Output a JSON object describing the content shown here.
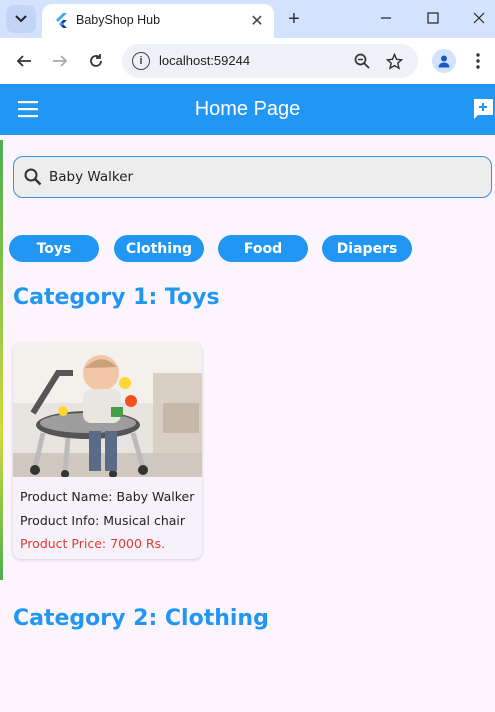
{
  "browser": {
    "tab_title": "BabyShop Hub",
    "url": "localhost:59244"
  },
  "app": {
    "title": "Home Page",
    "search": {
      "value": "Baby Walker"
    },
    "chips": [
      "Toys",
      "Clothing",
      "Food",
      "Diapers"
    ],
    "categories": [
      {
        "title": "Category 1: Toys"
      },
      {
        "title": "Category 2: Clothing"
      }
    ],
    "product": {
      "name_line": "Product Name: Baby Walker",
      "info_line": "Product Info: Musical chair",
      "price_line": "Product Price: 7000 Rs."
    }
  },
  "colors": {
    "primary": "#2196f3",
    "price": "#e53935",
    "background": "#fcf5fd"
  }
}
